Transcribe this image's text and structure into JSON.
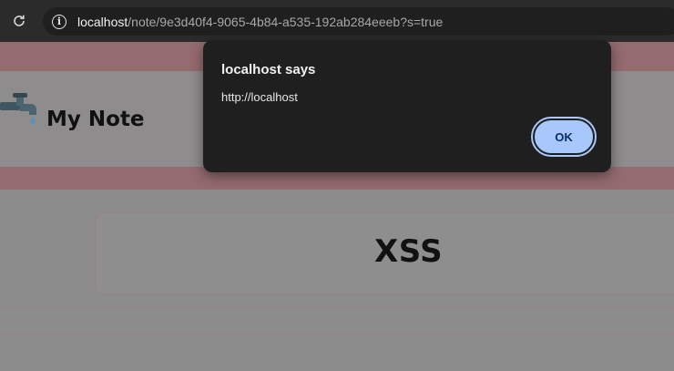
{
  "browser": {
    "url_host": "localhost",
    "url_path": "/note/9e3d40f4-9065-4b84-a535-192ab284eeeb?s=true"
  },
  "site": {
    "title": "My Note"
  },
  "note": {
    "title": "XSS"
  },
  "dialog": {
    "title": "localhost says",
    "message": "http://localhost",
    "ok_label": "OK"
  },
  "colors": {
    "accent_button": "#a8c7fa",
    "dialog_bg": "#1f1f1f",
    "browser_bar": "#2b2b2b"
  }
}
